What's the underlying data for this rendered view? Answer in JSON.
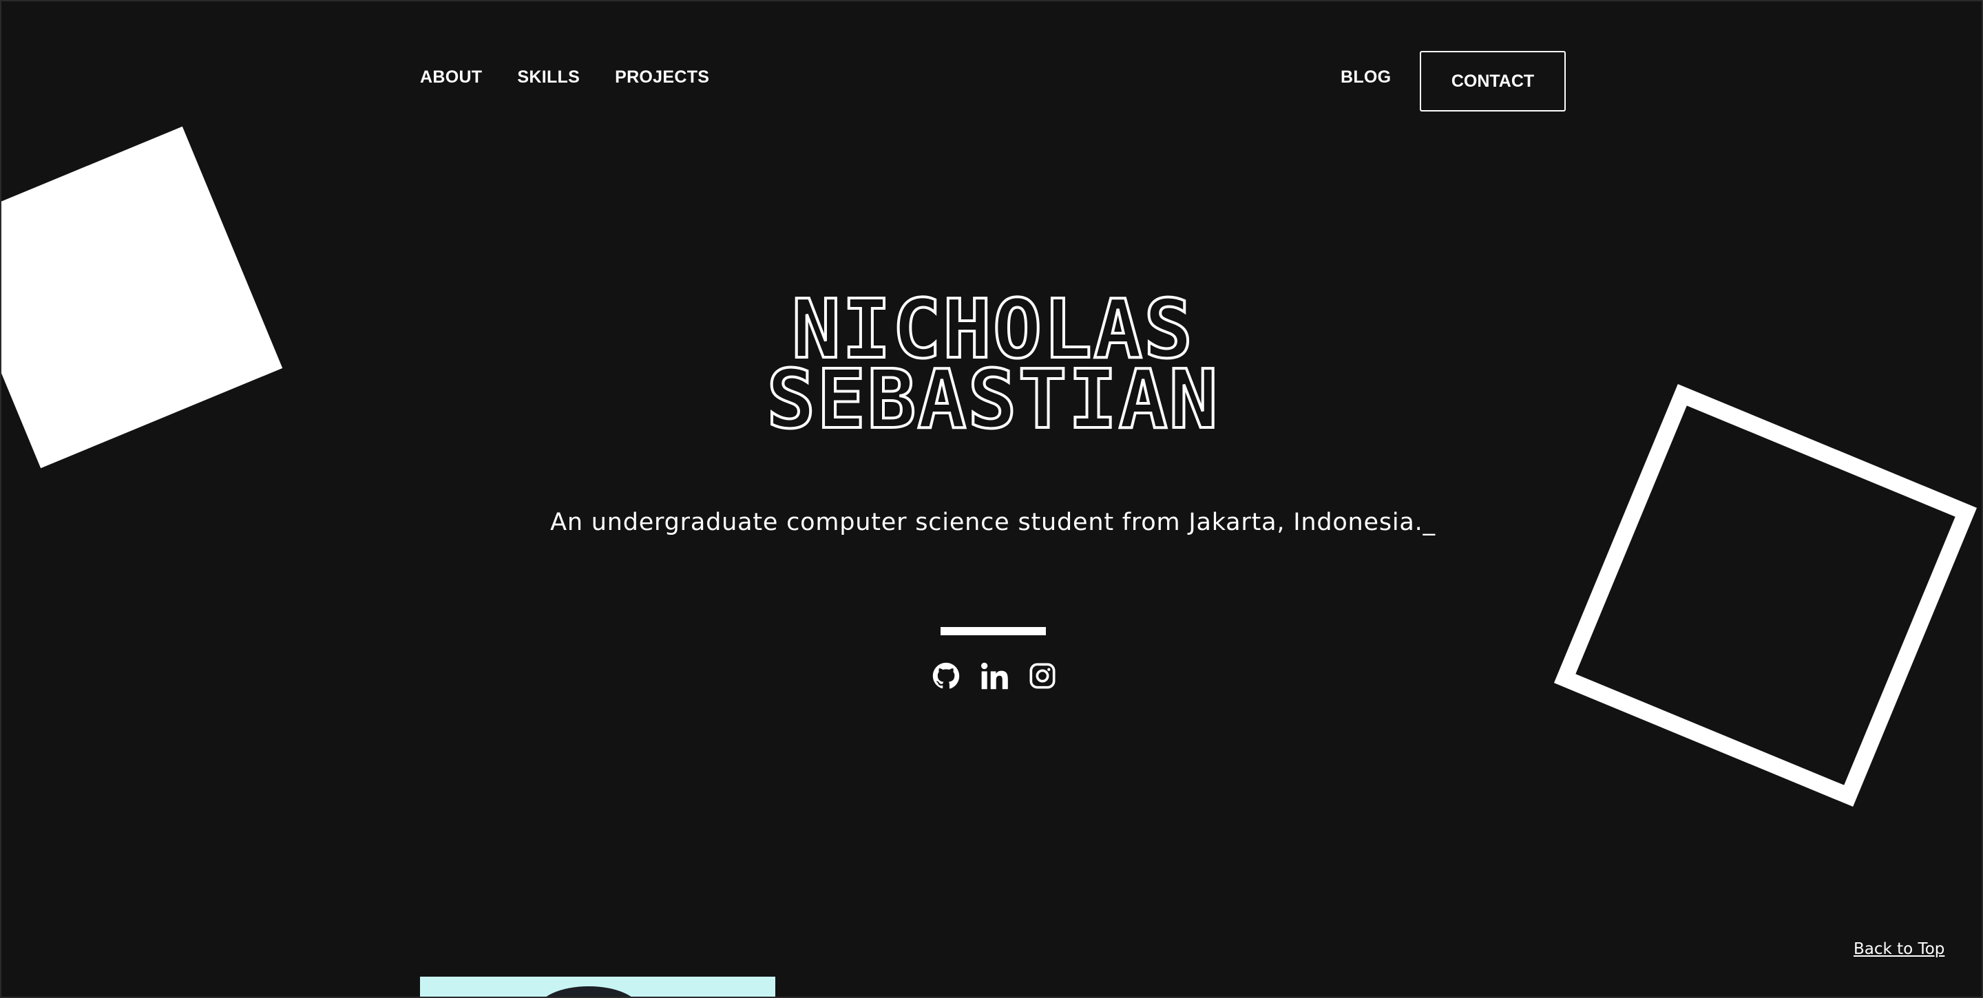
{
  "nav": {
    "about": "ABOUT",
    "skills": "SKILLS",
    "projects": "PROJECTS",
    "blog": "BLOG",
    "contact": "CONTACT"
  },
  "hero": {
    "name_line1": "NICHOLAS",
    "name_line2": "SEBASTIAN",
    "tagline": "An undergraduate computer science student from Jakarta, Indonesia._"
  },
  "socials": [
    {
      "icon": "github-icon"
    },
    {
      "icon": "linkedin-icon"
    },
    {
      "icon": "instagram-icon"
    }
  ],
  "footer": {
    "back_to_top": "Back to Top"
  },
  "colors": {
    "background": "#121212",
    "foreground": "#ffffff",
    "photo_bg": "#c8f4f4"
  }
}
